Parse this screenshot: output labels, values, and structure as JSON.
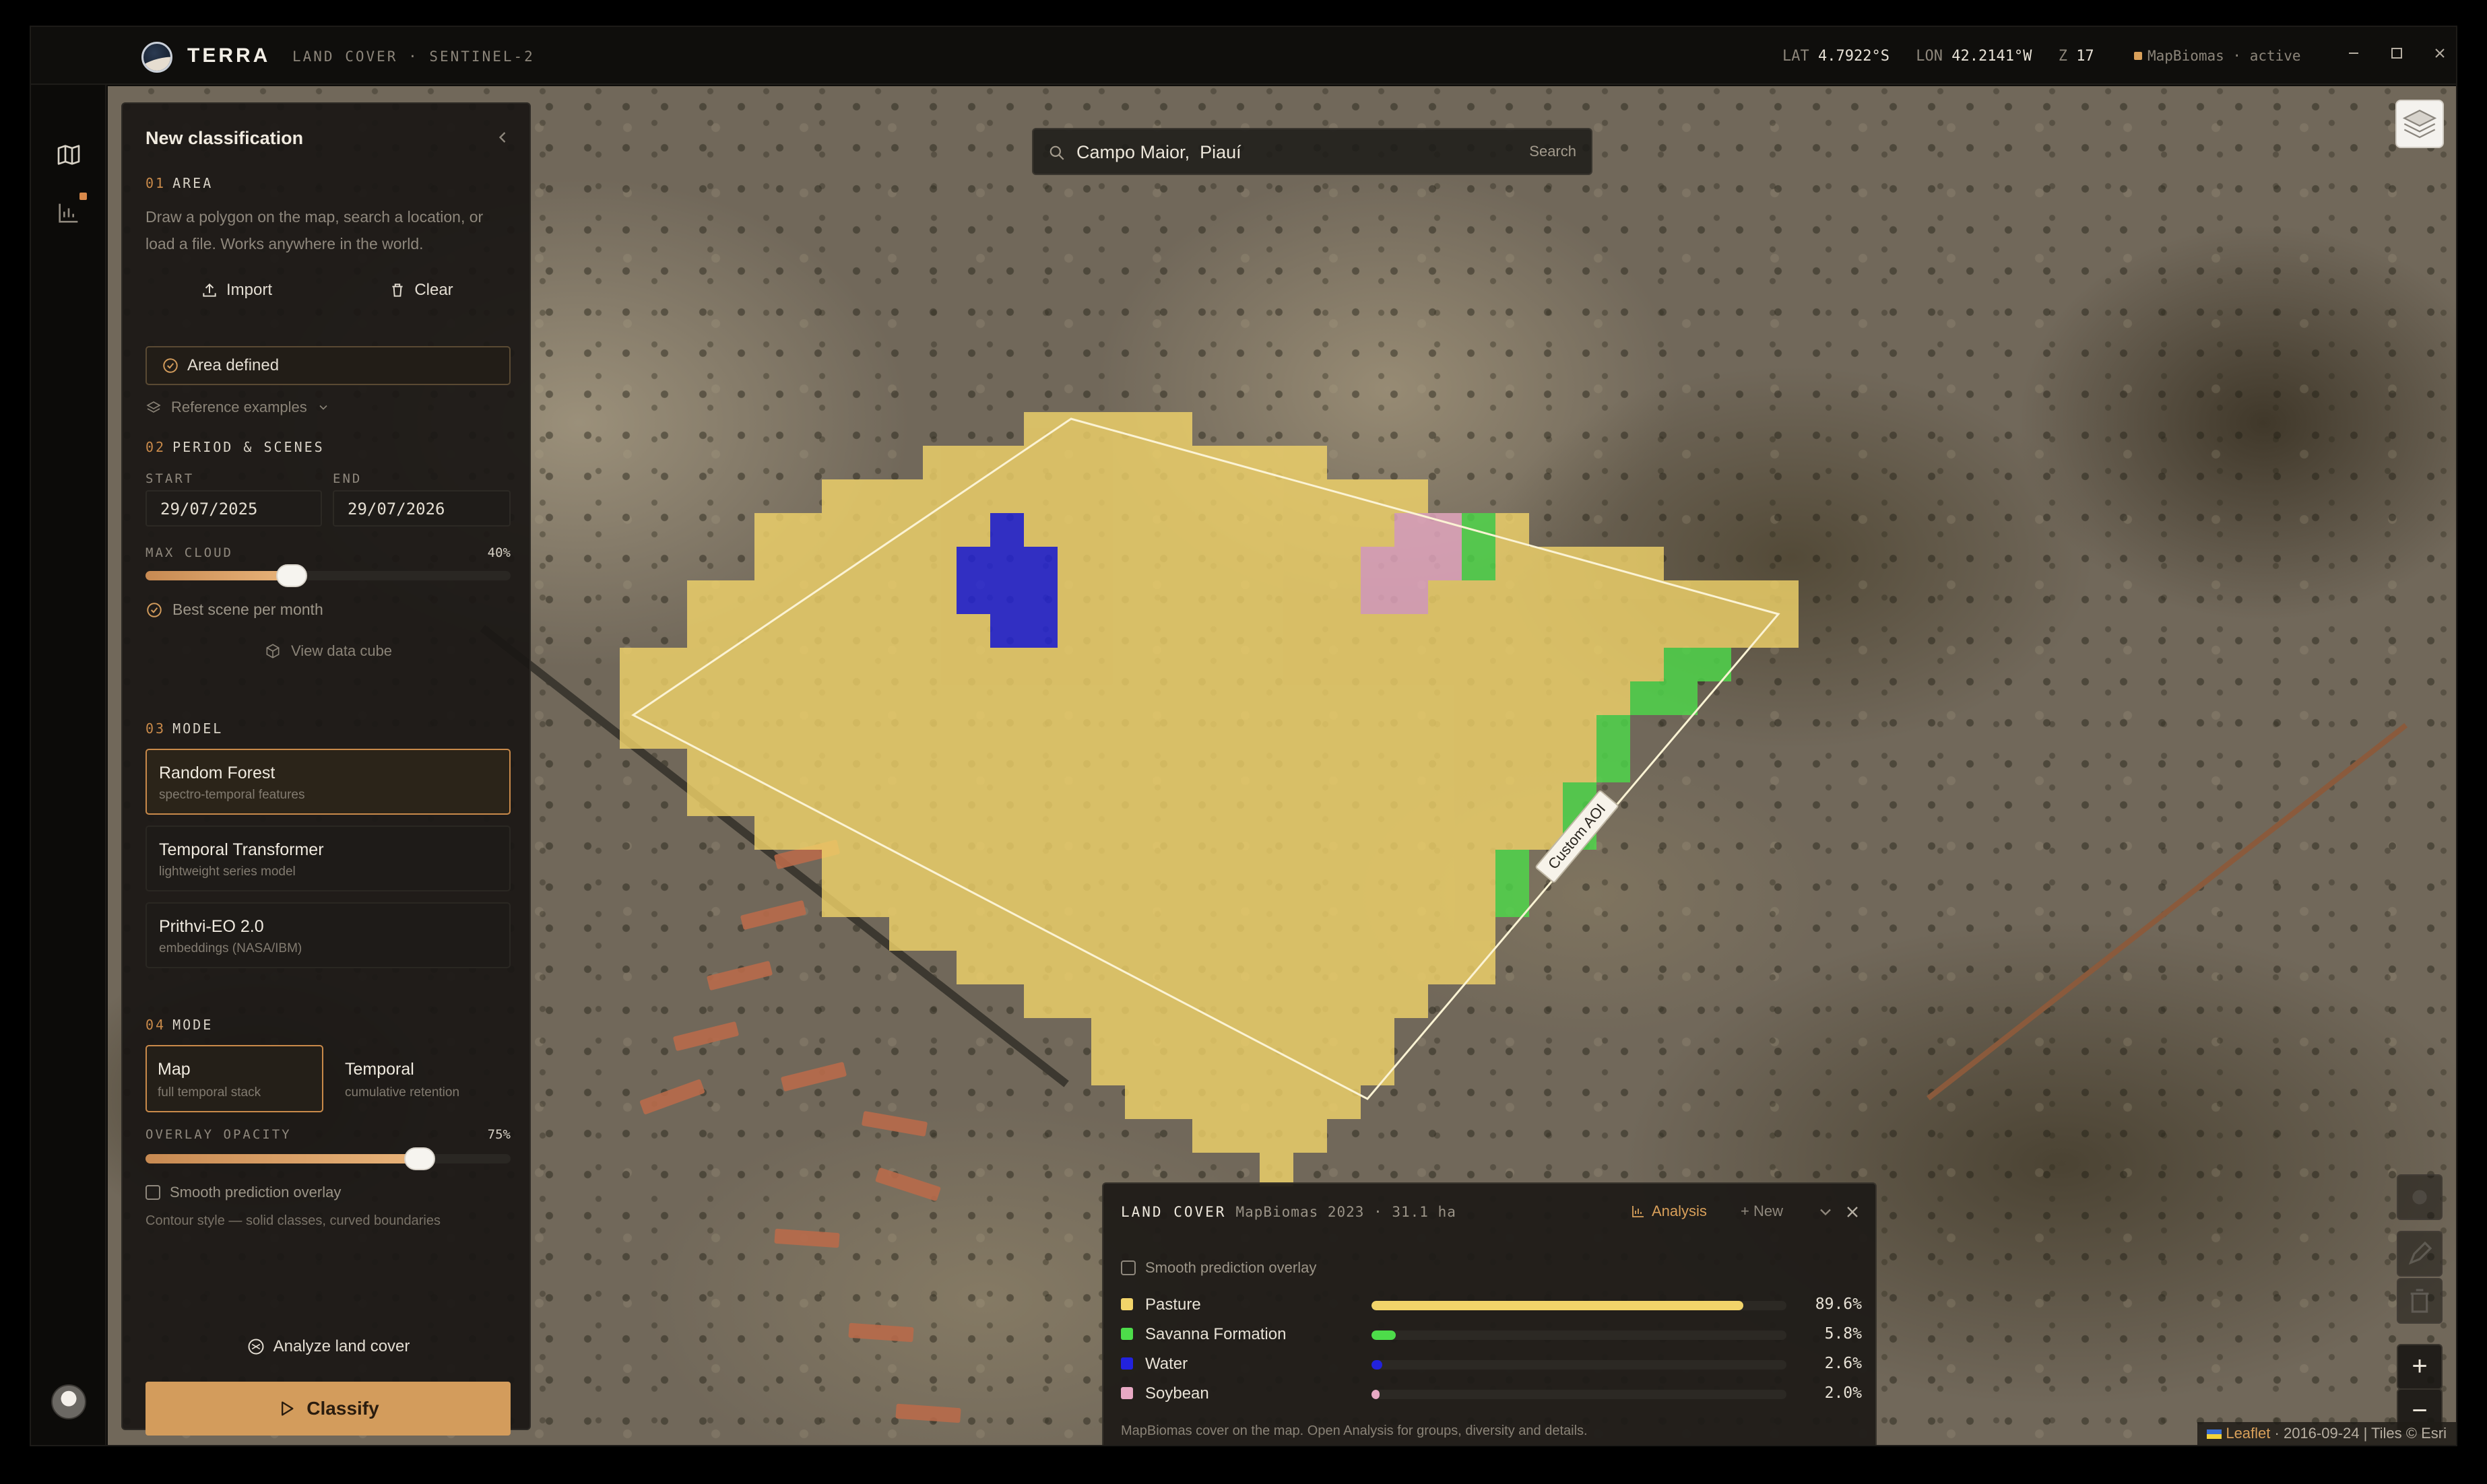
{
  "app": {
    "brand": "TERRA",
    "subtitle": "LAND COVER · SENTINEL-2"
  },
  "titlebar": {
    "lat_label": "LAT",
    "lat_value": "4.7922°S",
    "lon_label": "LON",
    "lon_value": "42.2141°W",
    "zoom_label": "Z",
    "zoom_value": "17",
    "status": "MapBiomas · active",
    "status_color": "#d9a05a"
  },
  "search": {
    "value": "Campo Maior,  Piauí",
    "button": "Search"
  },
  "panel": {
    "title": "New classification",
    "area": {
      "number": "01",
      "title": "AREA",
      "description": "Draw a polygon on the map, search a location, or load a file. Works anywhere in the world.",
      "import_label": "Import",
      "clear_label": "Clear",
      "defined_label": "Area defined",
      "reference_label": "Reference examples"
    },
    "period": {
      "number": "02",
      "title": "PERIOD & SCENES",
      "start_label": "START",
      "end_label": "END",
      "start": "29/07/2025",
      "end": "29/07/2026",
      "cloud_label": "MAX CLOUD",
      "cloud_value": "40%",
      "cloud_fraction": 0.4,
      "best_scene_label": "Best scene per month",
      "cube_label": "View data cube"
    },
    "model": {
      "number": "03",
      "title": "MODEL",
      "options": [
        {
          "title": "Random Forest",
          "subtitle": "spectro-temporal features"
        },
        {
          "title": "Temporal Transformer",
          "subtitle": "lightweight series model"
        },
        {
          "title": "Prithvi-EO 2.0",
          "subtitle": "embeddings (NASA/IBM)"
        }
      ],
      "selected_index": 0
    },
    "mode": {
      "number": "04",
      "title": "MODE",
      "options": [
        {
          "title": "Map",
          "subtitle": "full temporal stack"
        },
        {
          "title": "Temporal",
          "subtitle": "cumulative retention"
        }
      ],
      "opacity_label": "OVERLAY OPACITY",
      "opacity_value": "75%",
      "opacity_fraction": 0.75,
      "smooth_label": "Smooth prediction overlay",
      "smooth_hint": "Contour style — solid classes, curved boundaries"
    },
    "analyze_label": "Analyze land cover",
    "classify_label": "Classify"
  },
  "map": {
    "aoi_label": "Custom AOI"
  },
  "results": {
    "title": "LAND COVER",
    "meta": "MapBiomas 2023 · 31.1 ha",
    "analysis_label": "Analysis",
    "new_label": "+ New",
    "smooth_label": "Smooth prediction overlay",
    "classes": [
      {
        "name": "Pasture",
        "pct": "89.6%",
        "value": 89.6,
        "color": "#f2d46a"
      },
      {
        "name": "Savanna Formation",
        "pct": "5.8%",
        "value": 5.8,
        "color": "#4ddc4a"
      },
      {
        "name": "Water",
        "pct": "2.6%",
        "value": 2.6,
        "color": "#2222dd"
      },
      {
        "name": "Soybean",
        "pct": "2.0%",
        "value": 2.0,
        "color": "#e8a9c4"
      }
    ],
    "footer": "MapBiomas cover on the map. Open Analysis for groups, diversity and details."
  },
  "attribution": {
    "leaflet": "Leaflet",
    "text": "· 2016-09-24 | Tiles © Esri"
  },
  "colors": {
    "accent": "#d39c5c",
    "pasture": "#f2d46a",
    "savanna": "#4ddc4a",
    "water": "#2222dd",
    "soybean": "#e8a9c4"
  }
}
